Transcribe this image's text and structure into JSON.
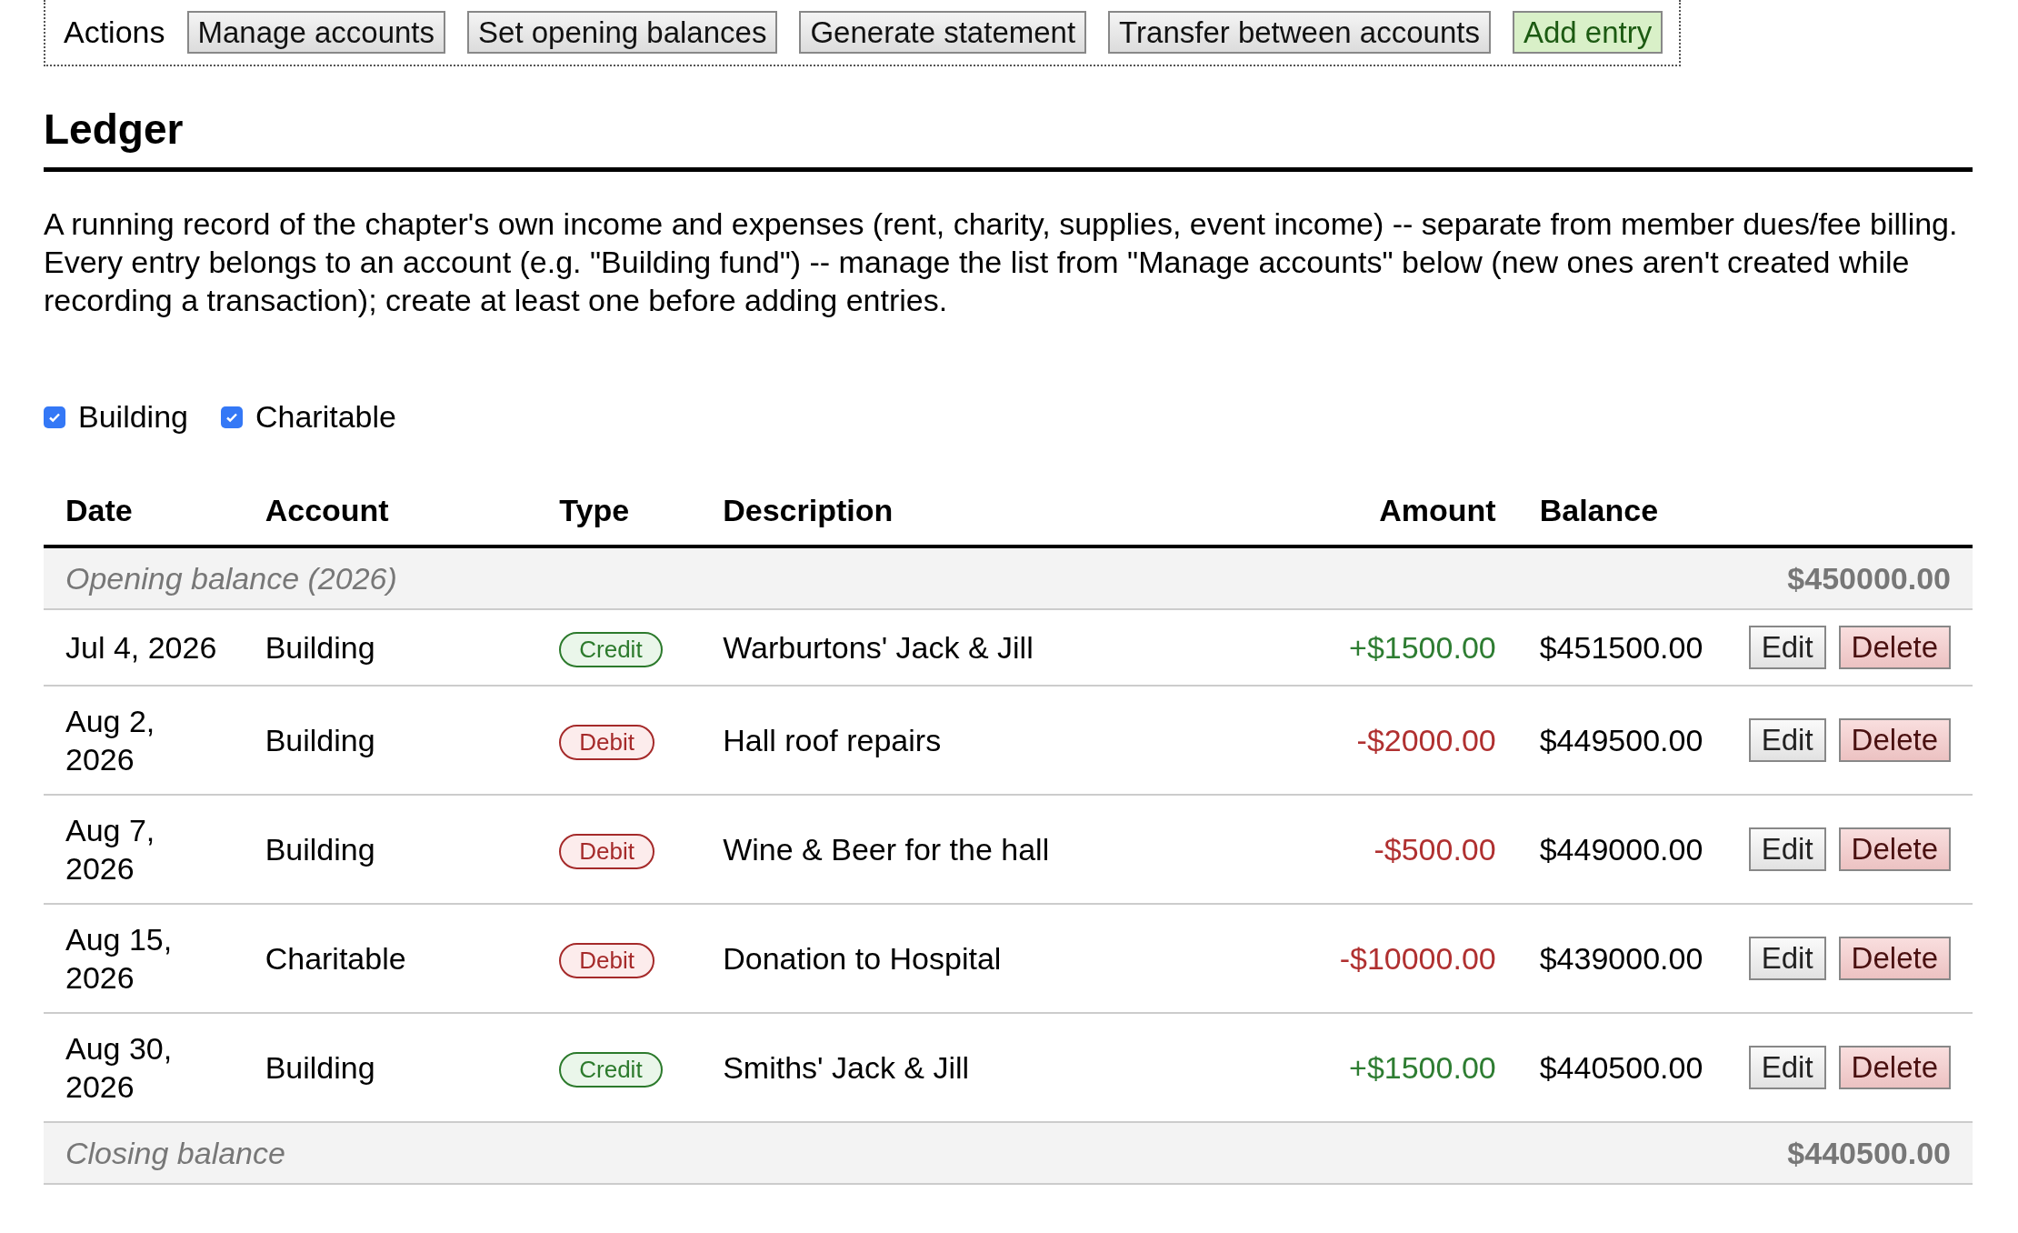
{
  "actions": {
    "label": "Actions",
    "buttons": [
      {
        "label": "Manage accounts",
        "kind": "plain"
      },
      {
        "label": "Set opening balances",
        "kind": "plain"
      },
      {
        "label": "Generate statement",
        "kind": "plain"
      },
      {
        "label": "Transfer between accounts",
        "kind": "plain"
      },
      {
        "label": "Add entry",
        "kind": "add"
      }
    ]
  },
  "heading": "Ledger",
  "intro": "A running record of the chapter's own income and expenses (rent, charity, supplies, event income) -- separate from member dues/fee billing. Every entry belongs to an account (e.g. \"Building fund\") -- manage the list from \"Manage accounts\" below (new ones aren't created while recording a transaction); create at least one before adding entries.",
  "filters": [
    {
      "label": "Building",
      "checked": true
    },
    {
      "label": "Charitable",
      "checked": true
    }
  ],
  "table": {
    "columns": [
      "Date",
      "Account",
      "Type",
      "Description",
      "Amount",
      "Balance"
    ],
    "opening": {
      "label": "Opening balance (2026)",
      "balance": "$450000.00"
    },
    "rows": [
      {
        "date": "Jul 4, 2026",
        "account": "Building",
        "type": "Credit",
        "kind": "credit",
        "description": "Warburtons' Jack & Jill",
        "amount": "+$1500.00",
        "balance": "$451500.00",
        "actions": [
          "Edit",
          "Delete"
        ]
      },
      {
        "date": "Aug 2, 2026",
        "account": "Building",
        "type": "Debit",
        "kind": "debit",
        "description": "Hall roof repairs",
        "amount": "-$2000.00",
        "balance": "$449500.00",
        "actions": [
          "Edit",
          "Delete"
        ]
      },
      {
        "date": "Aug 7, 2026",
        "account": "Building",
        "type": "Debit",
        "kind": "debit",
        "description": "Wine & Beer for the hall",
        "amount": "-$500.00",
        "balance": "$449000.00",
        "actions": [
          "Edit",
          "Delete"
        ]
      },
      {
        "date": "Aug 15, 2026",
        "account": "Charitable",
        "type": "Debit",
        "kind": "debit",
        "description": "Donation to Hospital",
        "amount": "-$10000.00",
        "balance": "$439000.00",
        "actions": [
          "Edit",
          "Delete"
        ]
      },
      {
        "date": "Aug 30, 2026",
        "account": "Building",
        "type": "Credit",
        "kind": "credit",
        "description": "Smiths' Jack & Jill",
        "amount": "+$1500.00",
        "balance": "$440500.00",
        "actions": [
          "Edit",
          "Delete"
        ]
      }
    ],
    "closing": {
      "label": "Closing balance",
      "balance": "$440500.00"
    }
  }
}
